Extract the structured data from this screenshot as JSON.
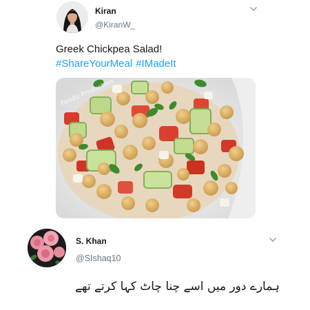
{
  "tweets": [
    {
      "display_name": "Kiran",
      "handle": "@KiranW_",
      "avatar_icon": "profile-photo-woman",
      "text_line": "Greek Chickpea Salad!",
      "hashtags": [
        "#ShareYourMeal",
        "#IMadeIt"
      ],
      "media": {
        "icon": "food-photo-greek-chickpea-salad",
        "watermark": "Fendu Production"
      },
      "menu_icon": "chevron-down-icon"
    },
    {
      "display_name": "S. Khan",
      "handle": "@SIshaq10",
      "avatar_icon": "profile-photo-pink-roses",
      "text_line": "ہمارے دور میں اسے چنا چاٹ کہا کرتے تھے",
      "menu_icon": "chevron-down-icon"
    }
  ],
  "colors": {
    "text": "#14171a",
    "secondary_text": "#657786",
    "hashtag": "#1da1f2",
    "background": "#ffffff"
  }
}
